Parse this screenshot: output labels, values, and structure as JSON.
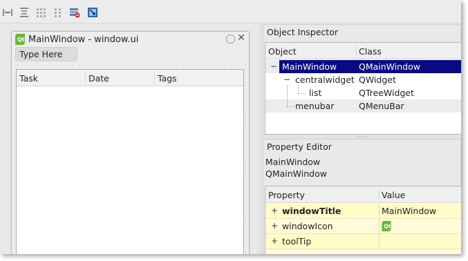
{
  "toolbar": {
    "buttons": [
      {
        "icon": "layout-horizontal-splitter-icon"
      },
      {
        "icon": "layout-vertical-splitter-icon"
      },
      {
        "icon": "layout-grid-icon"
      },
      {
        "icon": "layout-form-icon"
      },
      {
        "icon": "break-layout-icon"
      },
      {
        "icon": "adjust-size-icon"
      }
    ]
  },
  "form": {
    "title": "MainWindow - window.ui",
    "menubar_placeholder": "Type Here",
    "tree_columns": [
      "Task",
      "Date",
      "Tags"
    ]
  },
  "object_inspector": {
    "title": "Object Inspector",
    "columns": [
      "Object",
      "Class"
    ],
    "rows": [
      {
        "expander": "−",
        "object": "MainWindow",
        "class": "QMainWindow",
        "selected": true
      },
      {
        "expander": "−",
        "object": "centralwidget",
        "class": "QWidget",
        "selected": false
      },
      {
        "expander": "",
        "object": "list",
        "class": "QTreeWidget",
        "selected": false
      },
      {
        "expander": "",
        "object": "menubar",
        "class": "QMenuBar",
        "selected": false
      }
    ]
  },
  "property_editor": {
    "title": "Property Editor",
    "object_name": "MainWindow",
    "object_class": "QMainWindow",
    "columns": [
      "Property",
      "Value"
    ],
    "rows": [
      {
        "expander": "+",
        "property": "windowTitle",
        "value": "MainWindow",
        "bold": true
      },
      {
        "expander": "+",
        "property": "windowIcon",
        "value": "",
        "icon": "qt-logo-icon",
        "bold": false
      },
      {
        "expander": "+",
        "property": "toolTip",
        "value": "",
        "bold": false
      }
    ]
  },
  "colors": {
    "selection": "#0a0a80",
    "row_alt": "#ececec",
    "property_row": "#fffcc8",
    "property_row_alt": "#fffbd9"
  }
}
